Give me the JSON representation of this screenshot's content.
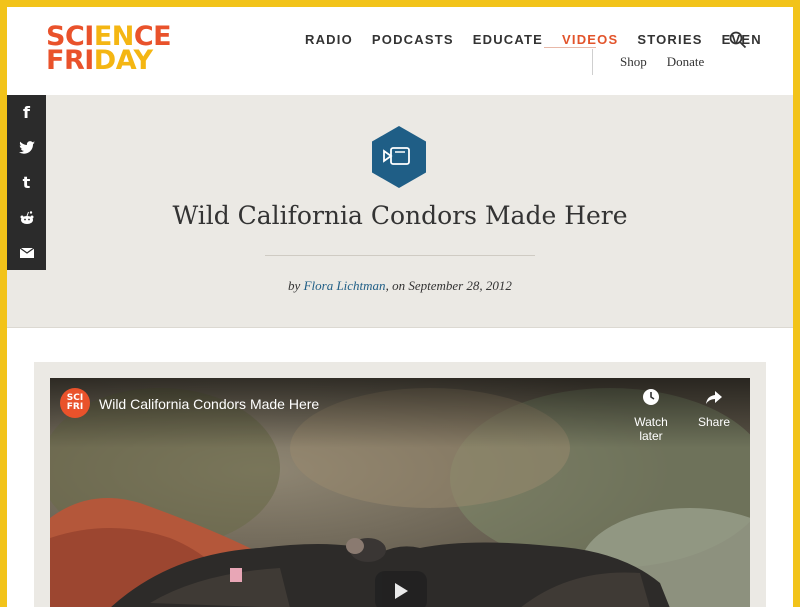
{
  "header": {
    "logo_line1": [
      "SCI",
      "EN",
      "CE"
    ],
    "logo_line2": [
      "FRI",
      "DAY"
    ],
    "nav": [
      {
        "label": "RADIO",
        "active": false
      },
      {
        "label": "PODCASTS",
        "active": false
      },
      {
        "label": "EDUCATE",
        "active": false
      },
      {
        "label": "VIDEOS",
        "active": true
      },
      {
        "label": "STORIES",
        "active": false
      },
      {
        "label": "EVEN",
        "active": false
      }
    ],
    "subnav": [
      "Shop",
      "Donate"
    ]
  },
  "article": {
    "title": "Wild California Condors Made Here",
    "by": "by ",
    "author": "Flora Lichtman",
    "date_text": ", on September 28, 2012"
  },
  "social": [
    "facebook-icon",
    "twitter-icon",
    "tumblr-icon",
    "reddit-icon",
    "email-icon"
  ],
  "video": {
    "channel_line1": "SCI",
    "channel_line2": "FRI",
    "title": "Wild California Condors Made Here",
    "watch_later": "Watch later",
    "share": "Share"
  },
  "colors": {
    "border": "#f2c31a",
    "accent": "#e2532a",
    "hex_badge": "#1f5e86",
    "band": "#ebe9e4"
  }
}
